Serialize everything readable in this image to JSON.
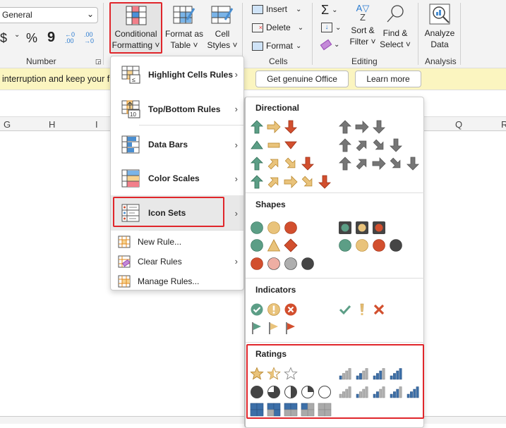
{
  "ribbon": {
    "number_format": "General",
    "number_buttons": [
      "$",
      "%",
      "9"
    ],
    "increase_decimal": "←0 .00",
    "decrease_decimal": ".00 →0",
    "groups": {
      "number": "Number",
      "cells": "Cells",
      "editing": "Editing",
      "analysis": "Analysis"
    },
    "conditional_formatting": [
      "Conditional",
      "Formatting ˅"
    ],
    "format_as_table": [
      "Format as",
      "Table ˅"
    ],
    "cell_styles": [
      "Cell",
      "Styles ˅"
    ],
    "insert": "Insert",
    "delete": "Delete",
    "format": "Format",
    "sort_filter": [
      "Sort &",
      "Filter ˅"
    ],
    "find_select": [
      "Find &",
      "Select ˅"
    ],
    "analyze_data": [
      "Analyze",
      "Data"
    ]
  },
  "message_bar": {
    "text": "interruption and keep your fil",
    "get_genuine": "Get genuine Office",
    "learn_more": "Learn more"
  },
  "columns": [
    "G",
    "H",
    "I",
    "Q",
    "R"
  ],
  "menu": {
    "items": [
      {
        "label": "Highlight Cells Rules",
        "icon": "highlight-cells-icon",
        "submenu": true
      },
      {
        "label": "Top/Bottom Rules",
        "icon": "top-bottom-icon",
        "submenu": true
      },
      {
        "label": "Data Bars",
        "icon": "data-bars-icon",
        "submenu": true
      },
      {
        "label": "Color Scales",
        "icon": "color-scales-icon",
        "submenu": true
      },
      {
        "label": "Icon Sets",
        "icon": "icon-sets-icon",
        "submenu": true,
        "selected": true
      },
      {
        "label": "New Rule...",
        "icon": "new-rule-icon"
      },
      {
        "label": "Clear Rules",
        "icon": "clear-rules-icon",
        "submenu": true
      },
      {
        "label": "Manage Rules...",
        "icon": "manage-rules-icon"
      }
    ]
  },
  "icon_sets": {
    "colors": {
      "green": "#5c9e86",
      "yellow": "#e9c37b",
      "red": "#d24f2e",
      "gray": "#767676",
      "pink": "#eeaea3",
      "lightgray": "#aeaeae",
      "black": "#454545",
      "blue": "#3c6fa8"
    },
    "sections": [
      {
        "title": "Directional",
        "sets": [
          [
            [
              "up",
              "green"
            ],
            [
              "right",
              "yellow"
            ],
            [
              "down",
              "red"
            ]
          ],
          [
            [
              "up",
              "gray"
            ],
            [
              "right",
              "gray"
            ],
            [
              "down",
              "gray"
            ]
          ],
          [
            [
              "tri-up",
              "green"
            ],
            [
              "dash",
              "yellow"
            ],
            [
              "tri-down",
              "red"
            ]
          ],
          [
            [
              "up",
              "gray"
            ],
            [
              "upright",
              "gray"
            ],
            [
              "downright",
              "gray"
            ],
            [
              "down",
              "gray"
            ]
          ],
          [
            [
              "up",
              "green"
            ],
            [
              "upright",
              "yellow"
            ],
            [
              "downright",
              "yellow"
            ],
            [
              "down",
              "red"
            ]
          ],
          [
            [
              "up",
              "gray"
            ],
            [
              "upright",
              "gray"
            ],
            [
              "right",
              "gray"
            ],
            [
              "downright",
              "gray"
            ],
            [
              "down",
              "gray"
            ]
          ],
          [
            [
              "up",
              "green"
            ],
            [
              "upright",
              "yellow"
            ],
            [
              "right",
              "yellow"
            ],
            [
              "downright",
              "yellow"
            ],
            [
              "down",
              "red"
            ]
          ]
        ]
      },
      {
        "title": "Shapes",
        "sets": [
          [
            [
              "circle",
              "green"
            ],
            [
              "circle",
              "yellow"
            ],
            [
              "circle",
              "red"
            ]
          ],
          [
            [
              "light",
              "green"
            ],
            [
              "light",
              "yellow"
            ],
            [
              "light",
              "red"
            ]
          ],
          [
            [
              "circle",
              "green"
            ],
            [
              "triangle",
              "yellow"
            ],
            [
              "diamond",
              "red"
            ]
          ],
          [
            [
              "circle",
              "green"
            ],
            [
              "circle",
              "yellow"
            ],
            [
              "circle",
              "red"
            ],
            [
              "circle",
              "black"
            ]
          ],
          [
            [
              "circle",
              "red"
            ],
            [
              "circle",
              "pink"
            ],
            [
              "circle",
              "lightgray"
            ],
            [
              "circle",
              "black"
            ]
          ]
        ]
      },
      {
        "title": "Indicators",
        "sets": [
          [
            [
              "check-circle",
              "green"
            ],
            [
              "excl-circle",
              "yellow"
            ],
            [
              "x-circle",
              "red"
            ]
          ],
          [
            [
              "check",
              "green"
            ],
            [
              "excl",
              "yellow"
            ],
            [
              "x",
              "red"
            ]
          ],
          [
            [
              "flag",
              "green"
            ],
            [
              "flag",
              "yellow"
            ],
            [
              "flag",
              "red"
            ]
          ]
        ]
      },
      {
        "title": "Ratings",
        "sets": [
          [
            [
              "star",
              1
            ],
            [
              "star",
              0.5
            ],
            [
              "star",
              0
            ]
          ],
          [
            [
              "bars",
              1
            ],
            [
              "bars",
              2
            ],
            [
              "bars",
              3
            ],
            [
              "bars",
              4
            ]
          ],
          [
            [
              "pie",
              1
            ],
            [
              "pie",
              0.75
            ],
            [
              "pie",
              0.5
            ],
            [
              "pie",
              0.25
            ],
            [
              "pie",
              0
            ]
          ],
          [
            [
              "bars",
              0
            ],
            [
              "bars",
              1
            ],
            [
              "bars",
              2
            ],
            [
              "bars",
              3
            ],
            [
              "bars",
              4
            ]
          ],
          [
            [
              "quad",
              4
            ],
            [
              "quad",
              3
            ],
            [
              "quad",
              2
            ],
            [
              "quad",
              1
            ],
            [
              "quad",
              0
            ]
          ]
        ]
      }
    ]
  }
}
